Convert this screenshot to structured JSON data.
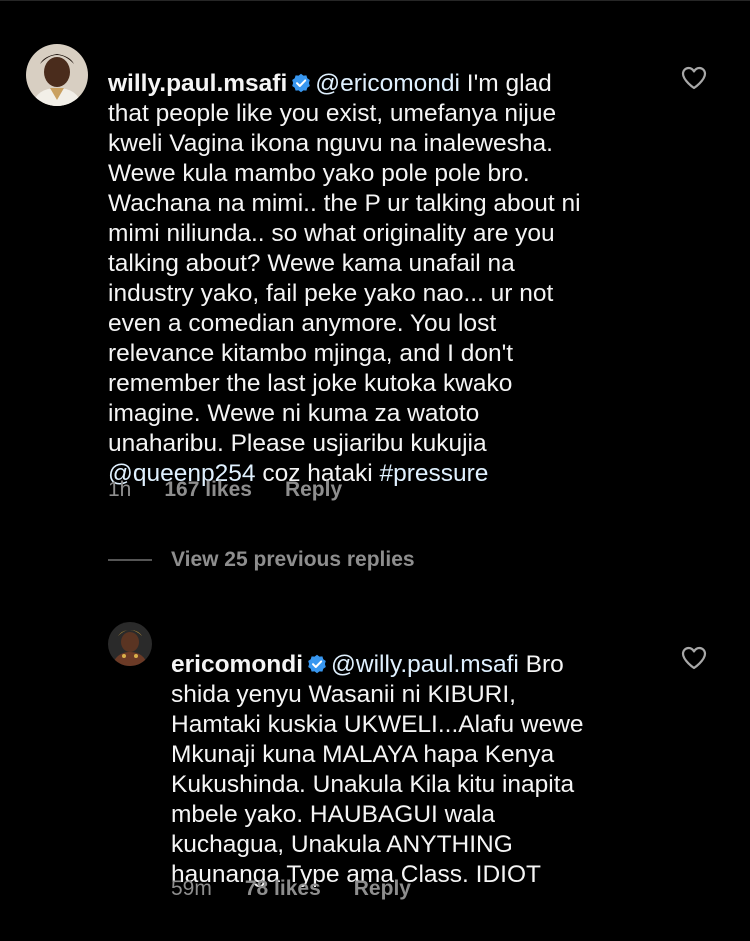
{
  "comments": [
    {
      "username": "willy.paul.msafi",
      "verified_icon": "verified-badge-icon",
      "mention": "@ericomondi",
      "text_lines": [
        " I'm glad",
        "that people like you exist, umefanya nijue",
        "kweli Vagina ikona nguvu na inalewesha.",
        "Wewe kula mambo yako pole pole bro.",
        "Wachana na mimi.. the P ur talking about ni",
        "mimi niliunda.. so what originality are you",
        "talking about? Wewe kama unafail na",
        "industry yako, fail peke yako nao... ur not",
        "even a comedian anymore. You lost",
        "relevance kitambo mjinga, and I don't",
        "remember the last joke kutoka kwako",
        "imagine. Wewe ni kuma za watoto",
        "unaharibu. Please usjiaribu kukujia"
      ],
      "last_line_mention": "@queenp254",
      "last_line_middle": " coz hataki ",
      "last_line_hashtag": "#pressure",
      "time": "1h",
      "likes": "167 likes",
      "reply_label": "Reply"
    },
    {
      "username": "ericomondi",
      "verified_icon": "verified-badge-icon",
      "mention": "@willy.paul.msafi",
      "text_lines": [
        " Bro",
        "shida yenyu Wasanii ni KIBURI,",
        "Hamtaki kuskia UKWELI...Alafu wewe",
        "Mkunaji kuna MALAYA hapa Kenya",
        "Kukushinda. Unakula Kila kitu inapita",
        "mbele yako. HAUBAGUI wala",
        "kuchagua, Unakula ANYTHING",
        "haunanga Type ama Class. IDIOT"
      ],
      "time": "59m",
      "likes": "78 likes",
      "reply_label": "Reply"
    }
  ],
  "view_replies_label": "View 25 previous replies",
  "colors": {
    "background": "#000000",
    "text": "#f5f5f5",
    "secondary": "#8e8e8e",
    "mention": "#e0f1ff",
    "verified": "#3897f0"
  }
}
